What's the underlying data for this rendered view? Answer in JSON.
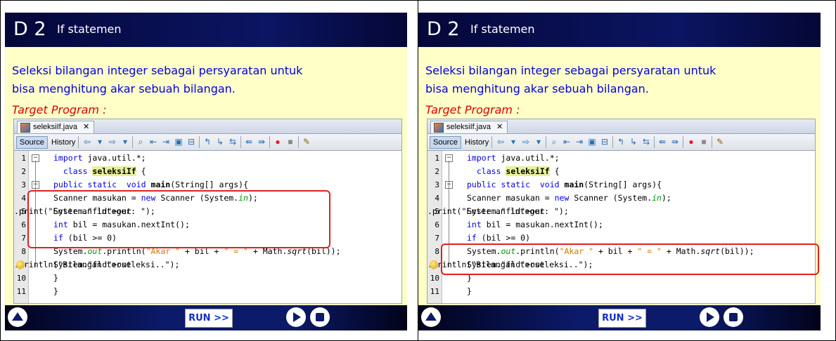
{
  "panels": [
    {
      "slide_code": "D 2",
      "slide_title": "If statemen",
      "description_lines": [
        "Seleksi bilangan integer sebagai persyaratan untuk",
        "bisa menghitung akar sebuah bilangan."
      ],
      "target_label": "Target Program :",
      "file_tab": "seleksiIf.java",
      "source_tab": "Source",
      "history_tab": "History",
      "highlighted_lines": [
        4,
        5,
        6,
        7
      ],
      "run_label": "RUN >>"
    },
    {
      "slide_code": "D 2",
      "slide_title": "If statemen",
      "description_lines": [
        "Seleksi bilangan integer sebagai persyaratan untuk",
        "bisa menghitung akar sebuah bilangan."
      ],
      "target_label": "Target Program :",
      "file_tab": "seleksiIf.java",
      "source_tab": "Source",
      "history_tab": "History",
      "highlighted_lines": [
        8,
        9
      ],
      "run_label": "RUN >>"
    }
  ],
  "code_lines": [
    {
      "num": "1",
      "text": "import java.util.*;"
    },
    {
      "num": "2",
      "text": "  class seleksiIf {"
    },
    {
      "num": "3",
      "text": "public static  void main(String[] args){"
    },
    {
      "num": "4",
      "text": "Scanner masukan = new Scanner (System.in);"
    },
    {
      "num": "5",
      "text": "System.out.print(\"Enter an integer: \");"
    },
    {
      "num": "6",
      "text": "int bil = masukan.nextInt();"
    },
    {
      "num": "7",
      "text": "if (bil >= 0)"
    },
    {
      "num": "8",
      "text": "System.out.println(\"Akar \" + bil + \" = \" + Math.sqrt(bil));"
    },
    {
      "num": "",
      "text": "System.out.println(\"Bilangan terseleksi..\");"
    },
    {
      "num": "10",
      "text": "}"
    },
    {
      "num": "11",
      "text": "}"
    }
  ],
  "colors": {
    "header": "#0b1562",
    "slide_bg": "#ffffc8",
    "description": "#0000e0",
    "target": "#e00000",
    "highlight_box": "#e02020",
    "keyword": "#0000e6",
    "string": "#ce7b00"
  },
  "icons": [
    "java-file-icon",
    "close-icon",
    "up-arrow-icon",
    "play-icon",
    "stop-icon",
    "hint-bulb-icon"
  ]
}
